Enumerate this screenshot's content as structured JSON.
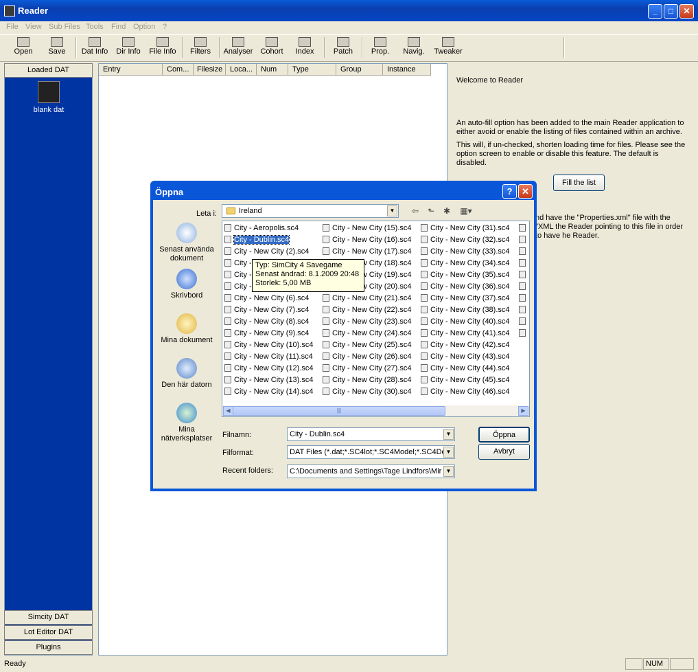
{
  "window": {
    "title": "Reader"
  },
  "menu": [
    "File",
    "View",
    "Sub Files",
    "Tools",
    "Find",
    "Option",
    "?"
  ],
  "toolbar": [
    "Open",
    "Save",
    "Dat Info",
    "Dir Info",
    "File Info",
    "Filters",
    "Analyser",
    "Cohort",
    "Index",
    "Patch",
    "Prop.",
    "Navig.",
    "Tweaker"
  ],
  "left_panel": {
    "top_tab": "Loaded DAT",
    "item_label": "blank dat",
    "bottom_tabs": [
      "Simcity DAT",
      "Lot Editor DAT",
      "Plugins"
    ]
  },
  "entry_columns": [
    "Entry",
    "Com...",
    "Filesize",
    "Loca...",
    "Num",
    "Type",
    "Group",
    "Instance"
  ],
  "info": {
    "welcome": "Welcome to Reader",
    "p1": "An auto-fill option has been added to the main Reader application to either avoid or enable the listing of files contained within an archive.",
    "p2": "This will, if un-checked, shorten loading time for files. Please see the option screen to enable or disable this feature. The default is disabled.",
    "fill_button": "Fill the list",
    "p3": "nd have the \"Properties.xml\" file with the \"XML the Reader pointing to this file in order to have he Reader."
  },
  "status": {
    "text": "Ready",
    "num": "NUM"
  },
  "dialog": {
    "title": "Öppna",
    "look_in_label": "Leta i:",
    "look_in_value": "Ireland",
    "places": [
      "Senast använda dokument",
      "Skrivbord",
      "Mina dokument",
      "Den här datorn",
      "Mina nätverksplatser"
    ],
    "files_col1": [
      "City - Aeropolis.sc4",
      "City - Dublin.sc4",
      "City - New City (2).sc4",
      "City - New City (3).sc4",
      "City - New City (4).sc4",
      "City - New City (5).sc4",
      "City - New City (6).sc4",
      "City - New City (7).sc4",
      "City - New City (8).sc4",
      "City - New City (9).sc4",
      "City - New City (10).sc4",
      "City - New City (11).sc4",
      "City - New City (12).sc4",
      "City - New City (13).sc4",
      "City - New City (14).sc4"
    ],
    "files_col2": [
      "City - New City (15).sc4",
      "City - New City (16).sc4",
      "City - New City (17).sc4",
      "City - New City (18).sc4",
      "City - New City (19).sc4",
      "City - New City (20).sc4",
      "City - New City (21).sc4",
      "City - New City (22).sc4",
      "City - New City (23).sc4",
      "City - New City (24).sc4",
      "City - New City (25).sc4",
      "City - New City (26).sc4",
      "City - New City (27).sc4",
      "City - New City (28).sc4",
      "City - New City (30).sc4"
    ],
    "files_col3": [
      "City - New City (31).sc4",
      "City - New City (32).sc4",
      "City - New City (33).sc4",
      "City - New City (34).sc4",
      "City - New City (35).sc4",
      "City - New City (36).sc4",
      "City - New City (37).sc4",
      "City - New City (38).sc4",
      "City - New City (40).sc4",
      "City - New City (41).sc4",
      "City - New City (42).sc4",
      "City - New City (43).sc4",
      "City - New City (44).sc4",
      "City - New City (45).sc4",
      "City - New City (46).sc4"
    ],
    "tooltip": [
      "Typ: SimCity 4 Savegame",
      "Senast ändrad: 8.1.2009 20:48",
      "Storlek: 5,00 MB"
    ],
    "filename_label": "Filnamn:",
    "filename_value": "City - Dublin.sc4",
    "format_label": "Filformat:",
    "format_value": "DAT Files (*.dat;*.SC4lot;*.SC4Model;*.SC4Des",
    "recent_label": "Recent folders:",
    "recent_value": "C:\\Documents and Settings\\Tage Lindfors\\Mir",
    "open_button": "Öppna",
    "cancel_button": "Avbryt"
  }
}
